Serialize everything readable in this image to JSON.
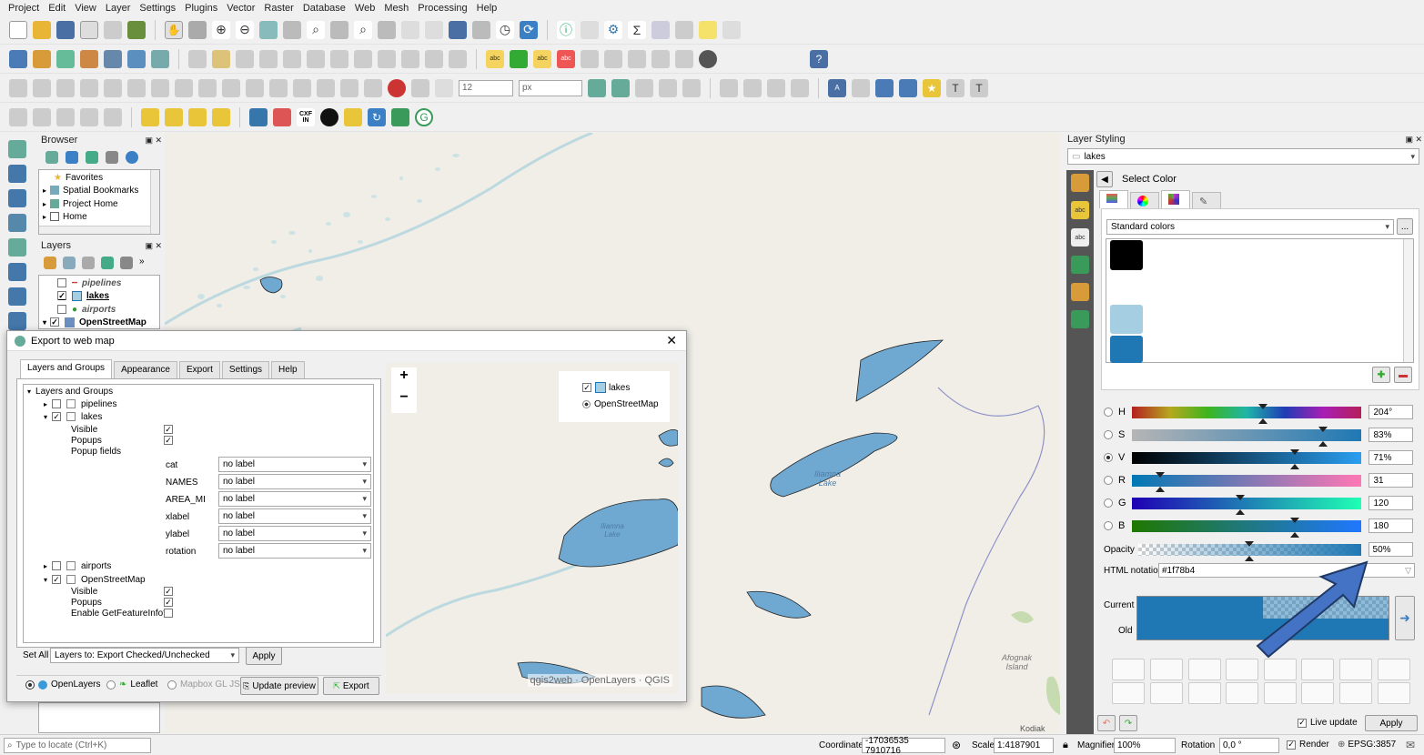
{
  "menu": [
    "Project",
    "Edit",
    "View",
    "Layer",
    "Settings",
    "Plugins",
    "Vector",
    "Raster",
    "Database",
    "Web",
    "Mesh",
    "Processing",
    "Help"
  ],
  "toolbar": {
    "font_size": "12",
    "font_unit": "px",
    "cxf_line1": "CXF",
    "cxf_line2": "IN"
  },
  "browser": {
    "title": "Browser",
    "items": [
      "Favorites",
      "Spatial Bookmarks",
      "Project Home",
      "Home"
    ]
  },
  "layers": {
    "title": "Layers",
    "items": [
      "pipelines",
      "lakes",
      "airports",
      "OpenStreetMap"
    ]
  },
  "dialog": {
    "title": "Export to web map",
    "tabs": [
      "Layers and Groups",
      "Appearance",
      "Export",
      "Settings",
      "Help"
    ],
    "tree_root": "Layers and Groups",
    "pipelines": "pipelines",
    "lakes": "lakes",
    "lakes_visible": "Visible",
    "lakes_popups": "Popups",
    "popup_fields": "Popup fields",
    "fields": [
      {
        "name": "cat",
        "value": "no label"
      },
      {
        "name": "NAMES",
        "value": "no label"
      },
      {
        "name": "AREA_MI",
        "value": "no label"
      },
      {
        "name": "xlabel",
        "value": "no label"
      },
      {
        "name": "ylabel",
        "value": "no label"
      },
      {
        "name": "rotation",
        "value": "no label"
      }
    ],
    "airports": "airports",
    "osm": "OpenStreetMap",
    "osm_visible": "Visible",
    "osm_popups": "Popups",
    "osm_getfeature": "Enable GetFeatureInfo?",
    "set_all_label": "Set All",
    "set_all_value": "Layers to: Export Checked/Unchecked",
    "apply": "Apply",
    "engines": [
      "OpenLayers",
      "Leaflet",
      "Mapbox GL JS"
    ],
    "update_preview": "Update preview",
    "export": "Export",
    "preview": {
      "zoom_in": "+",
      "zoom_out": "−",
      "legend": [
        "lakes",
        "OpenStreetMap"
      ],
      "attribution": "qgis2web · OpenLayers · QGIS",
      "lake_label": "Iliamna\nLake"
    }
  },
  "map_labels": {
    "lake": "Iliamna\nLake",
    "island": "Afognak\nIsland",
    "kodiak": "Kodiak"
  },
  "styling": {
    "title": "Layer Styling",
    "layer": "lakes",
    "select_color": "Select Color",
    "palette": "Standard colors",
    "palette_more": "...",
    "channels": [
      {
        "label": "H",
        "value": "204°",
        "pos": 0.57
      },
      {
        "label": "S",
        "value": "83%",
        "pos": 0.83
      },
      {
        "label": "V",
        "value": "71%",
        "pos": 0.71
      },
      {
        "label": "R",
        "value": "31",
        "pos": 0.12
      },
      {
        "label": "G",
        "value": "120",
        "pos": 0.47
      },
      {
        "label": "B",
        "value": "180",
        "pos": 0.71
      }
    ],
    "opacity_label": "Opacity",
    "opacity_value": "50%",
    "html_label": "HTML notation",
    "html_value": "#1f78b4",
    "current": "Current",
    "old": "Old",
    "live_update": "Live update",
    "apply": "Apply",
    "colors": {
      "main": "#1f78b4",
      "light": "#a6cee3",
      "black": "#000000"
    }
  },
  "status": {
    "locate_placeholder": "Type to locate (Ctrl+K)",
    "coordinate_label": "Coordinate",
    "coordinate_value": "-17036535 7910716",
    "scale_label": "Scale",
    "scale_value": "1:4187901",
    "magnifier_label": "Magnifier",
    "magnifier_value": "100%",
    "rotation_label": "Rotation",
    "rotation_value": "0,0 °",
    "render_label": "Render",
    "crs": "EPSG:3857"
  }
}
